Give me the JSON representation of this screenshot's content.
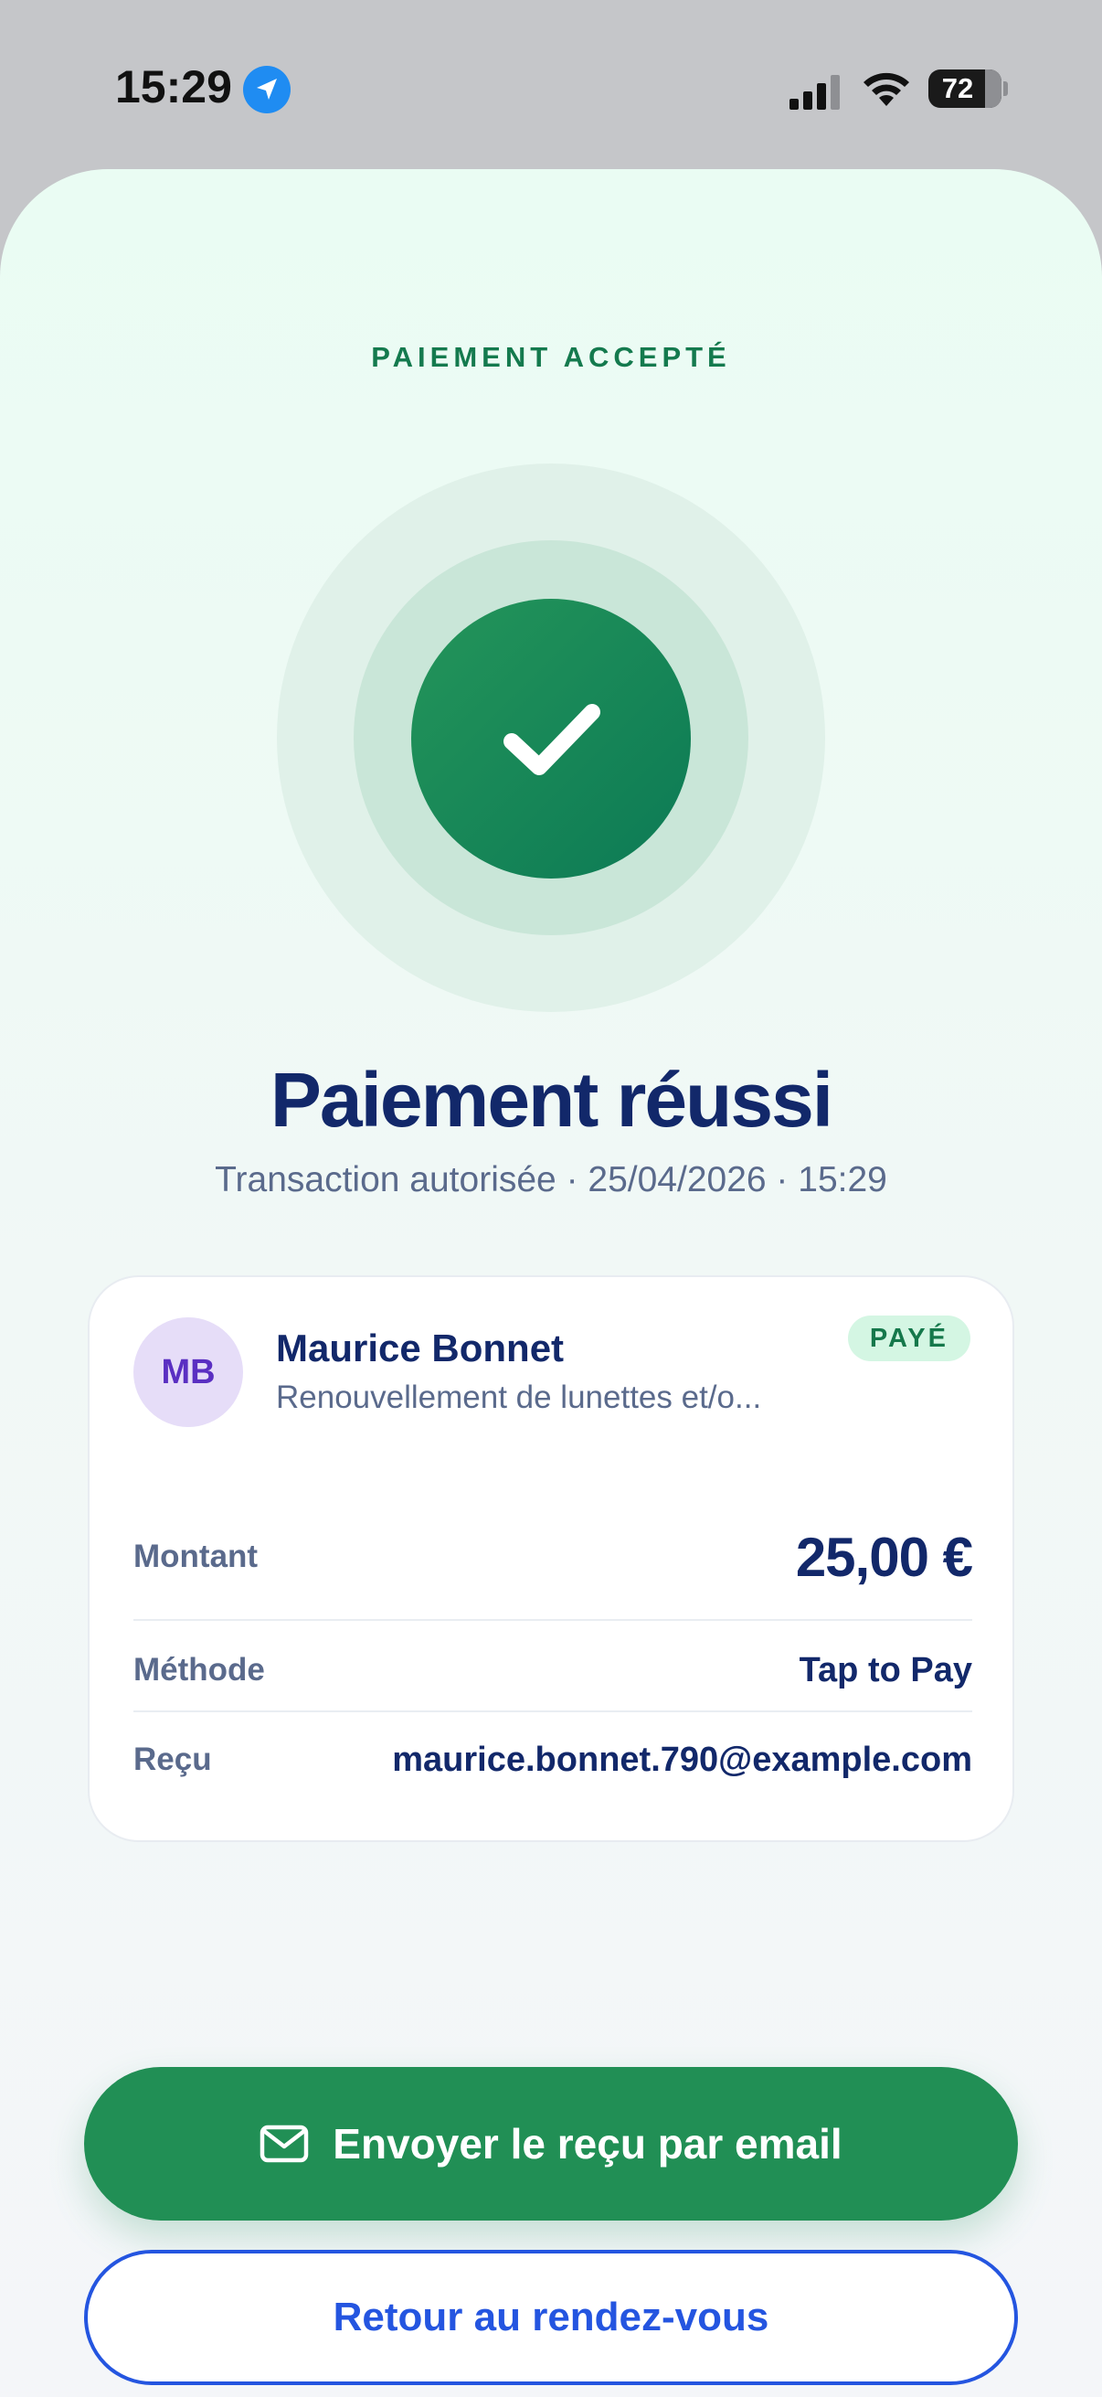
{
  "status_bar": {
    "time": "15:29",
    "battery": "72"
  },
  "header": {
    "eyebrow": "PAIEMENT ACCEPTÉ",
    "title": "Paiement réussi",
    "subtitle": "Transaction autorisée · 25/04/2026 · 15:29"
  },
  "client": {
    "initials": "MB",
    "name": "Maurice Bonnet",
    "description": "Renouvellement de lunettes et/o...",
    "status": "PAYÉ"
  },
  "details": {
    "amount_label": "Montant",
    "amount_value": "25,00 €",
    "method_label": "Méthode",
    "method_value": "Tap to Pay",
    "receipt_label": "Reçu",
    "receipt_value": "maurice.bonnet.790@example.com"
  },
  "actions": {
    "send_receipt": "Envoyer le reçu par email",
    "back": "Retour au rendez-vous"
  },
  "colors": {
    "accent_green": "#218f55",
    "navy": "#12286a",
    "link_blue": "#2455e0",
    "avatar_purple": "#5a2fc2"
  }
}
